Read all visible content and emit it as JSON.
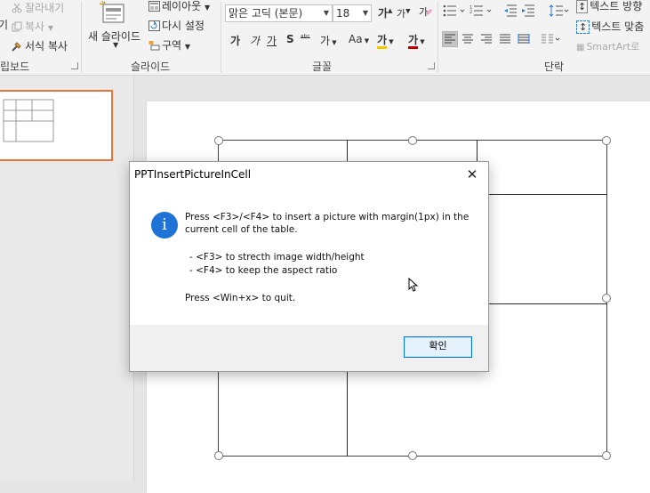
{
  "ribbon": {
    "clipboard": {
      "cut": "잘라내기",
      "copy": "복사",
      "format_painter": "서식 복사",
      "partial_left": "기",
      "label": "립보드"
    },
    "slides": {
      "new_slide": "새 슬라이드",
      "layout": "레이아웃",
      "reset": "다시 설정",
      "section": "구역",
      "label": "슬라이드"
    },
    "font": {
      "font_name": "맑은 고딕 (본문)",
      "font_size": "18",
      "grow": "가",
      "shrink": "가",
      "bold": "가",
      "italic": "가",
      "underline": "가",
      "shadow": "S",
      "strike": "ᵃᵇᶜ",
      "spacing": "가",
      "case": "Aa",
      "highlight": "가",
      "color": "가",
      "label": "글꼴"
    },
    "paragraph": {
      "text_direction": "텍스트 방향",
      "align_text": "텍스트 맞춤",
      "smartart": "SmartArt로",
      "label": "단락"
    }
  },
  "dialog": {
    "title": "PPTInsertPictureInCell",
    "close": "✕",
    "icon": "i",
    "lines": [
      "Press <F3>/<F4> to insert a picture with margin(1px) in the",
      "current cell of the table.",
      "- <F3> to strecth image width/height",
      "- <F4> to keep the aspect ratio",
      "Press <Win+x> to quit."
    ],
    "ok": "확인"
  },
  "colors": {
    "accent": "#e8763a",
    "info_blue": "#1f73d6",
    "ok_border": "#0078d7",
    "highlight_yellow": "#f2c600",
    "font_red": "#c00000"
  },
  "icons": [
    "scissors-icon",
    "copy-icon",
    "format-painter-icon",
    "new-slide-icon",
    "layout-icon",
    "reset-icon",
    "section-icon",
    "info-icon",
    "close-icon",
    "mouse-cursor-icon"
  ]
}
